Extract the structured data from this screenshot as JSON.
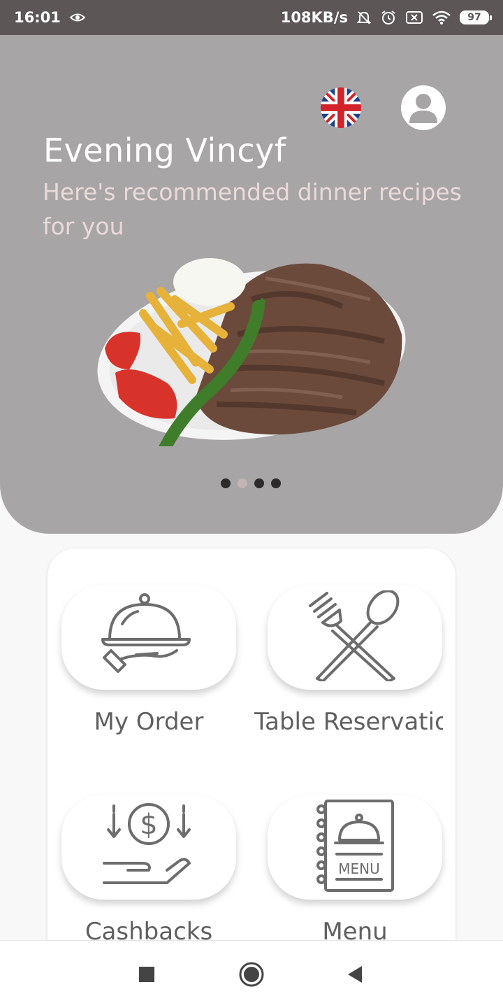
{
  "status_bar": {
    "time": "16:01",
    "speed": "108KB/s",
    "battery": "97"
  },
  "hero": {
    "greeting": "Evening Vincyf",
    "subtitle": "Here's recommended dinner recipes for you",
    "carousel": {
      "count": 4,
      "active_index": 1
    }
  },
  "tiles": [
    {
      "label": "My Order",
      "icon": "food-cloche-hand-icon"
    },
    {
      "label": "Table Reservatio",
      "icon": "fork-spoon-icon"
    },
    {
      "label": "Cashbacks",
      "icon": "money-hand-icon"
    },
    {
      "label": "Menu",
      "icon": "menu-book-icon"
    }
  ],
  "colors": {
    "status_bar": "#5c5657",
    "hero_bg": "#a8a5a6",
    "subtitle": "#eadada",
    "tile_label": "#5f5f5f",
    "icon_stroke": "#6d6d6d"
  }
}
